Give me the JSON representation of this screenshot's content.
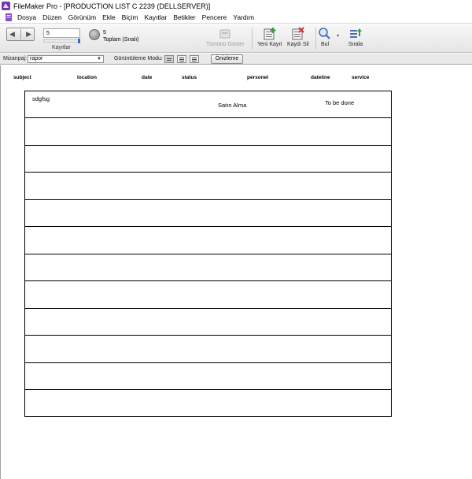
{
  "window": {
    "title": "FileMaker Pro - [PRODUCTION LIST C 2239 (DELLSERVER)]"
  },
  "menu": [
    "Dosya",
    "Düzen",
    "Görünüm",
    "Ekle",
    "Biçim",
    "Kayıtlar",
    "Betikler",
    "Pencere",
    "Yardım"
  ],
  "toolbar": {
    "record_number": "5",
    "records_label": "Kayıtlar",
    "total_count": "5",
    "total_label": "Toplam (Sıralı)",
    "show_all_label": "Tümünü Göster",
    "new_record_label": "Yeni Kayıt",
    "delete_record_label": "Kaydı Sil",
    "find_label": "Bul",
    "sort_label": "Sırala"
  },
  "layoutbar": {
    "layout_label": "Mizanpaj:",
    "layout_value": "rapor",
    "view_mode_label": "Görüntüleme Modu:",
    "preview_label": "Önizleme"
  },
  "columns": [
    "subject",
    "location",
    "date",
    "status",
    "personel",
    "dateline",
    "service"
  ],
  "rows": [
    {
      "subject": "sdgfsg",
      "personel": "Satın Alma",
      "service": "To be done"
    },
    {},
    {},
    {},
    {},
    {},
    {},
    {},
    {},
    {},
    {},
    {}
  ],
  "colors": {
    "toolbar_bg": "#ececec",
    "accent": "#2a6fc9",
    "border": "#000000"
  }
}
